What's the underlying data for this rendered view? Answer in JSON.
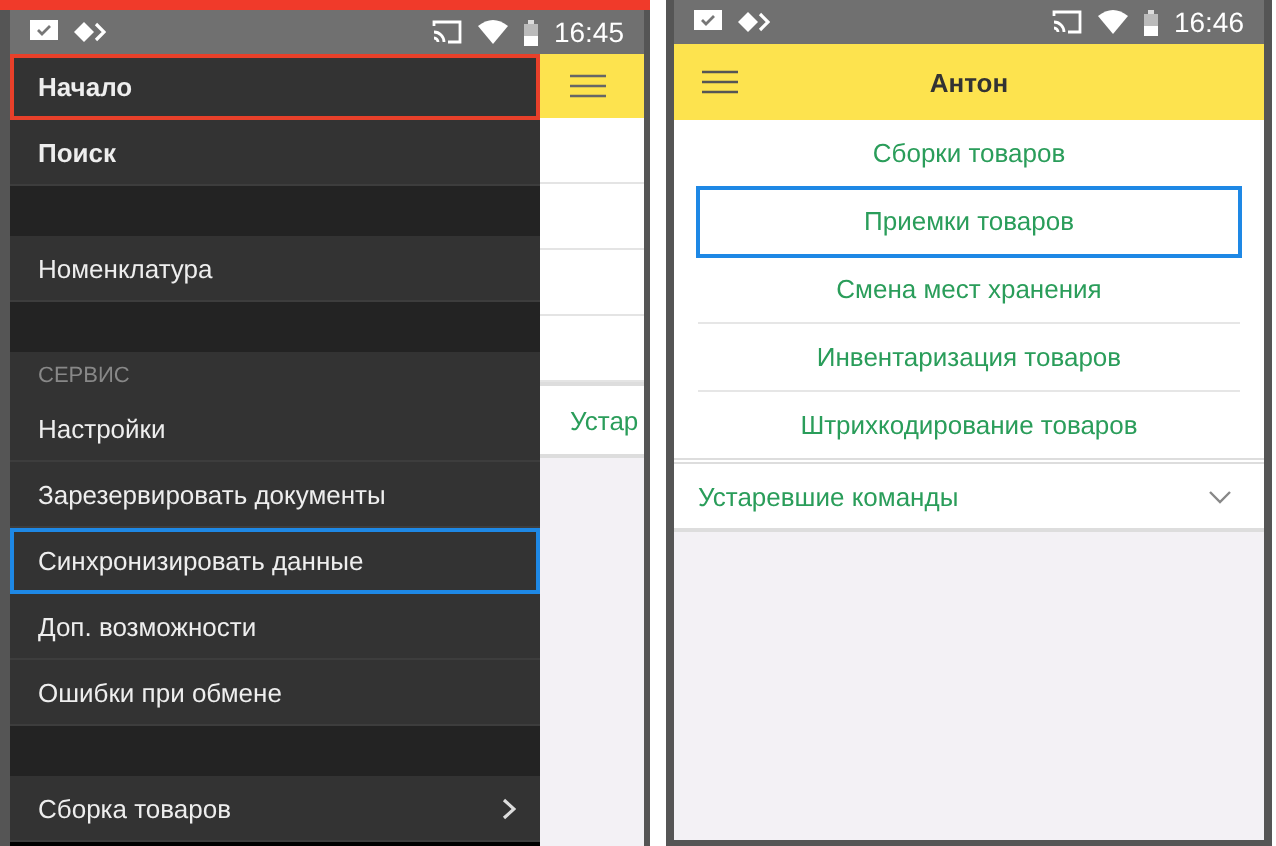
{
  "left_phone": {
    "status_bar": {
      "time": "16:45"
    },
    "background_screen": {
      "row_count_hint": "Устар"
    },
    "drawer": {
      "sections": [
        {
          "items": [
            {
              "label": "Начало",
              "bold": true,
              "color": "#e8402a",
              "has_submenu": false
            },
            {
              "label": "Поиск",
              "bold": true,
              "has_submenu": false
            }
          ]
        },
        {
          "items": [
            {
              "label": "Номенклатура",
              "bold": false,
              "has_submenu": false
            }
          ]
        },
        {
          "header": "СЕРВИС",
          "items": [
            {
              "label": "Настройки",
              "bold": false,
              "has_submenu": false
            },
            {
              "label": "Зарезервировать документы",
              "bold": false,
              "has_submenu": false
            },
            {
              "label": "Синхронизировать данные",
              "bold": false,
              "color": "#1e88e5",
              "has_submenu": false
            },
            {
              "label": "Доп. возможности",
              "bold": false,
              "has_submenu": false
            },
            {
              "label": "Ошибки при обмене",
              "bold": false,
              "has_submenu": false
            }
          ]
        },
        {
          "items": [
            {
              "label": "Сборка товаров",
              "bold": false,
              "has_submenu": true
            }
          ]
        }
      ]
    }
  },
  "right_phone": {
    "status_bar": {
      "time": "16:46"
    },
    "title": "Антон",
    "commands": [
      {
        "label": "Сборки товаров"
      },
      {
        "label": "Приемки товаров",
        "color": "#1e88e5"
      },
      {
        "label": "Смена мест хранения"
      },
      {
        "label": "Инвентаризация товаров"
      },
      {
        "label": "Штрихкодирование товаров"
      }
    ],
    "group": {
      "label": "Устаревшие команды",
      "expanded": false
    }
  }
}
